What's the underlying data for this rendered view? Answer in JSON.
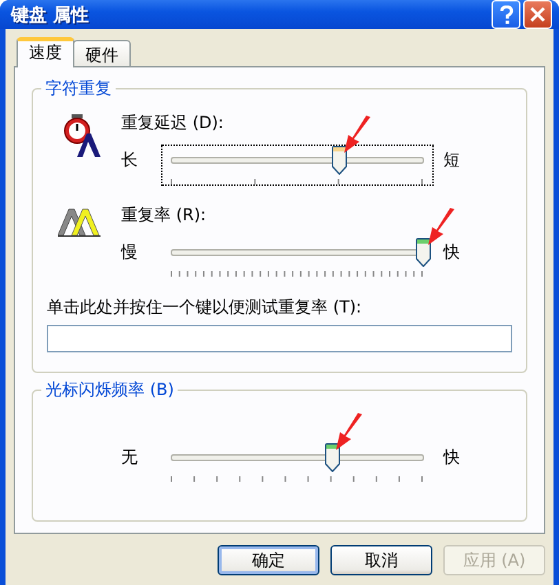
{
  "window": {
    "title": "键盘 属性"
  },
  "tabs": [
    {
      "label": "速度",
      "selected": true
    },
    {
      "label": "硬件",
      "selected": false
    }
  ],
  "groups": [
    {
      "title": "字符重复",
      "settings": [
        {
          "kind": "delay",
          "label": "重复延迟 (D):",
          "min_label": "长",
          "max_label": "短",
          "level": 0.667,
          "focused": true
        },
        {
          "kind": "rate",
          "label": "重复率 (R):",
          "min_label": "慢",
          "max_label": "快",
          "level": 1,
          "focused": false
        }
      ],
      "test_field": {
        "label": "单击此处并按住一个键以便测试重复率 (T):"
      }
    },
    {
      "title": "光标闪烁频率 (B)",
      "settings": [
        {
          "kind": "blink",
          "min_label": "无",
          "max_label": "快",
          "level": 0.636,
          "focused": false
        }
      ]
    }
  ],
  "buttons": [
    {
      "label": "确定",
      "default": true,
      "disabled": false
    },
    {
      "label": "取消",
      "default": false,
      "disabled": false
    },
    {
      "label": "应用 (A)",
      "default": false,
      "disabled": true
    }
  ]
}
